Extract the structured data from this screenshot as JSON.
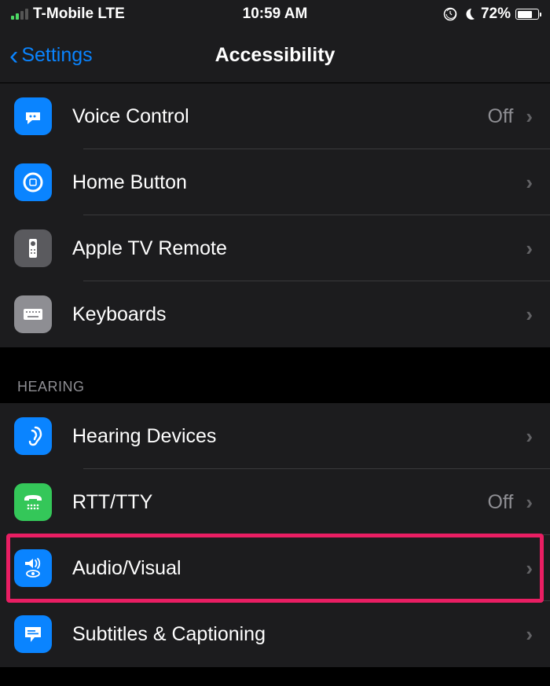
{
  "status": {
    "carrier": "T-Mobile LTE",
    "time": "10:59 AM",
    "battery": "72%"
  },
  "nav": {
    "back": "Settings",
    "title": "Accessibility"
  },
  "rows": {
    "voice_control": {
      "label": "Voice Control",
      "value": "Off"
    },
    "home_button": {
      "label": "Home Button"
    },
    "apple_tv_remote": {
      "label": "Apple TV Remote"
    },
    "keyboards": {
      "label": "Keyboards"
    },
    "hearing_devices": {
      "label": "Hearing Devices"
    },
    "rtt_tty": {
      "label": "RTT/TTY",
      "value": "Off"
    },
    "audio_visual": {
      "label": "Audio/Visual"
    },
    "subtitles": {
      "label": "Subtitles & Captioning"
    }
  },
  "sections": {
    "hearing": "HEARING"
  }
}
